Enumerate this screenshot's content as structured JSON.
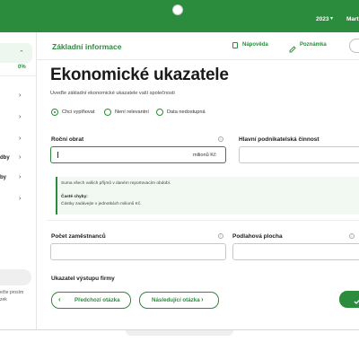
{
  "topbar": {
    "year": "2023",
    "year_chevron": "▾",
    "user": "Mart"
  },
  "sidebar": {
    "progress_pct": "0%",
    "items": [
      {
        "label": ""
      },
      {
        "label": ""
      },
      {
        "label": ""
      },
      {
        "label": ""
      },
      {
        "label": "dby"
      },
      {
        "label": "by"
      },
      {
        "label": ""
      }
    ],
    "footer_lines": [
      "ečte prosím",
      "zek"
    ]
  },
  "header": {
    "section_title": "Základní informace",
    "help_label": "Nápověda",
    "notes_label": "Poznámka"
  },
  "page": {
    "title": "Ekonomické ukazatele",
    "subtitle": "Uveďte základní ekonomické ukazatele vaší společnosti"
  },
  "radios": [
    {
      "label": "Chci vyplňovat",
      "selected": true
    },
    {
      "label": "Není relevantní",
      "selected": false
    },
    {
      "label": "Data nedostupná",
      "selected": false
    }
  ],
  "fields": {
    "turnover": {
      "label": "Roční obrat",
      "value": "",
      "unit": "milionů Kč"
    },
    "main_activity": {
      "label": "Hlavní podnikatelská činnost",
      "value": ""
    },
    "employees": {
      "label": "Počet zaměstnanců",
      "value": ""
    },
    "floor_area": {
      "label": "Podlahová plocha",
      "value": ""
    },
    "output_indicator": {
      "label": "Ukazatel výstupu firmy"
    }
  },
  "hint": {
    "text": "Suma všech vašich příjmů v daném reportovacím období.",
    "errors_title": "Časté chyby:",
    "errors_text": "Částky zadávejte v jednotkách milionů Kč."
  },
  "nav": {
    "prev_label": "Předchozí otázka",
    "next_label": "Následující otázka",
    "prev_icon": "‹",
    "next_icon": "›"
  },
  "colors": {
    "accent": "#2a8c3c",
    "hint_bg": "#f1f9f2"
  }
}
